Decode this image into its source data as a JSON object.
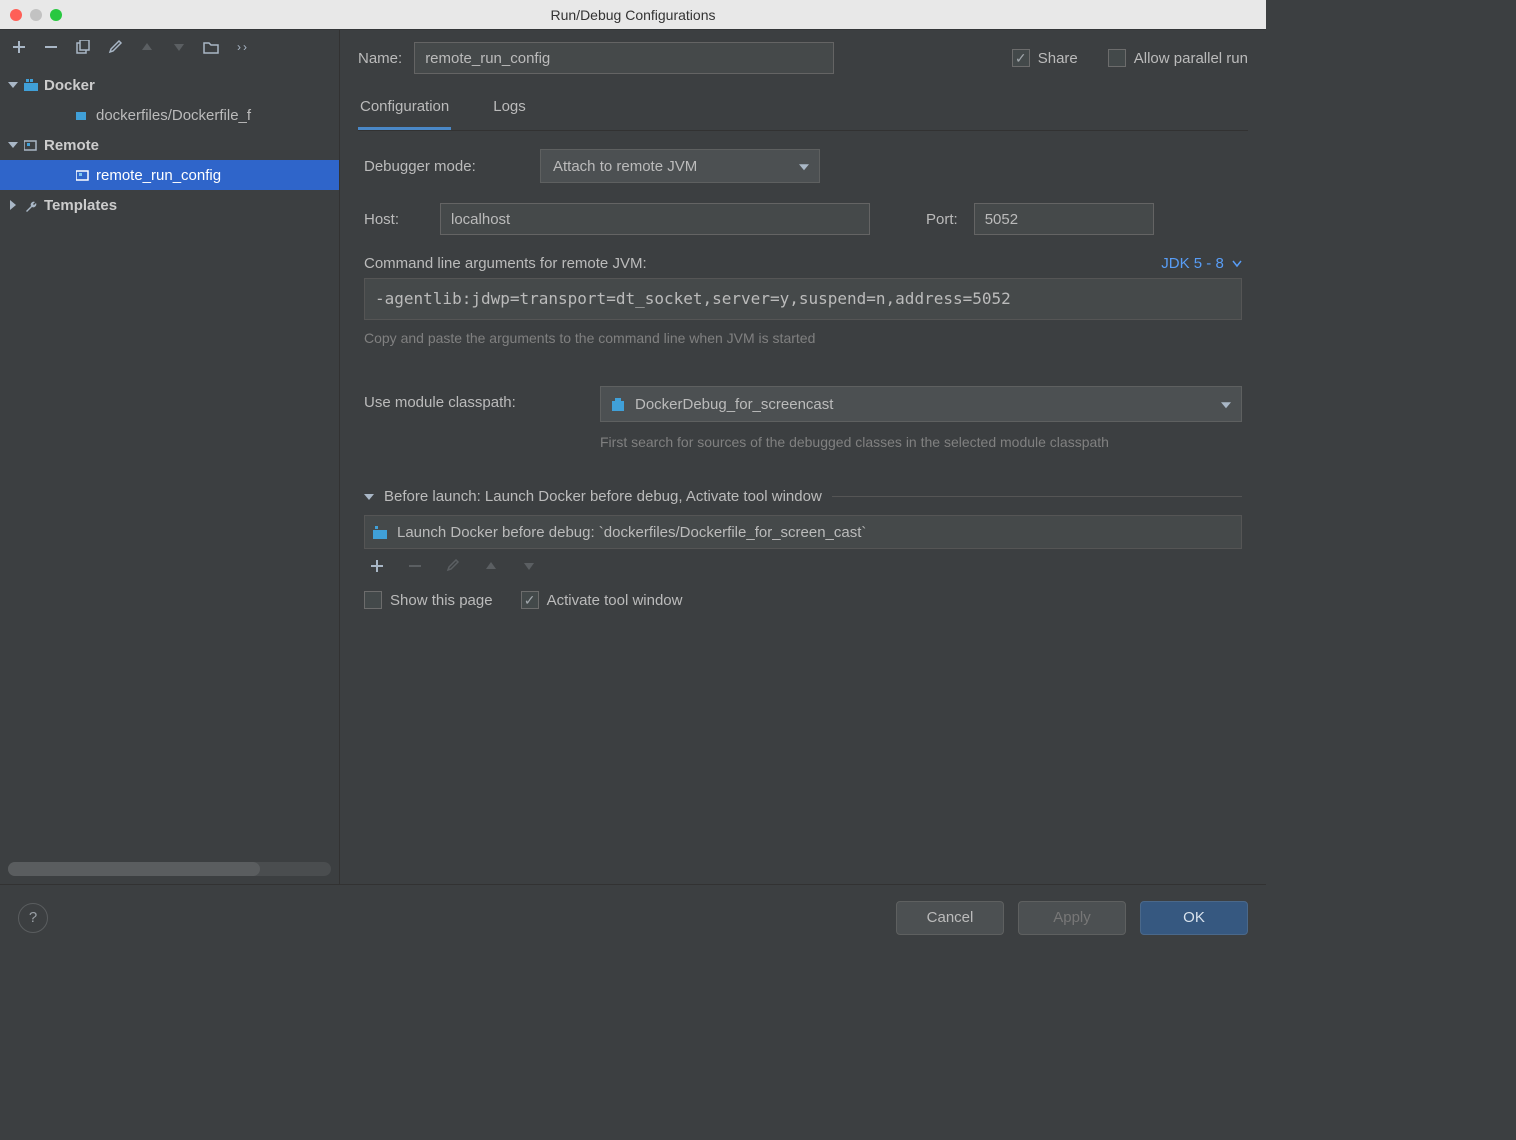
{
  "window": {
    "title": "Run/Debug Configurations"
  },
  "tree": {
    "docker": {
      "label": "Docker",
      "child": "dockerfiles/Dockerfile_f"
    },
    "remote": {
      "label": "Remote",
      "child": "remote_run_config"
    },
    "templates": {
      "label": "Templates"
    }
  },
  "top": {
    "name_label": "Name:",
    "name_value": "remote_run_config",
    "share_label": "Share",
    "allow_parallel_label": "Allow parallel run"
  },
  "tabs": {
    "configuration": "Configuration",
    "logs": "Logs"
  },
  "config": {
    "debugger_mode_label": "Debugger mode:",
    "debugger_mode_value": "Attach to remote JVM",
    "host_label": "Host:",
    "host_value": "localhost",
    "port_label": "Port:",
    "port_value": "5052",
    "cmd_label": "Command line arguments for remote JVM:",
    "jdk_label": "JDK 5 - 8",
    "cmd_value": "-agentlib:jdwp=transport=dt_socket,server=y,suspend=n,address=5052",
    "cmd_hint": "Copy and paste the arguments to the command line when JVM is started",
    "module_label": "Use module classpath:",
    "module_value": "DockerDebug_for_screencast",
    "module_hint": "First search for sources of the debugged classes in the selected module classpath"
  },
  "before_launch": {
    "header": "Before launch: Launch Docker before debug, Activate tool window",
    "item": "Launch Docker before debug: `dockerfiles/Dockerfile_for_screen_cast`",
    "show_page": "Show this page",
    "activate_tool": "Activate tool window"
  },
  "footer": {
    "cancel": "Cancel",
    "apply": "Apply",
    "ok": "OK"
  }
}
